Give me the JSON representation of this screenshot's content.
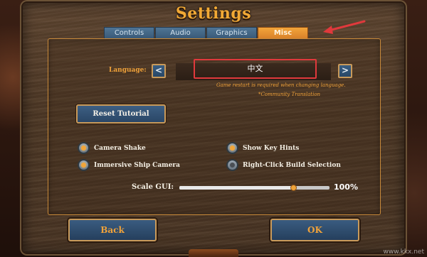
{
  "window": {
    "title": "Settings"
  },
  "tabs": [
    {
      "label": "Controls",
      "active": false
    },
    {
      "label": "Audio",
      "active": false
    },
    {
      "label": "Graphics",
      "active": false
    },
    {
      "label": "Misc",
      "active": true
    }
  ],
  "language": {
    "label": "Language:",
    "value": "中文",
    "prev_icon": "chevron-left-icon",
    "next_icon": "chevron-right-icon",
    "prev_glyph": "<",
    "next_glyph": ">",
    "restart_note": "Game restart is required when changing language.",
    "community_note": "*Community Translation"
  },
  "reset_tutorial": {
    "label": "Reset Tutorial"
  },
  "options": [
    {
      "label": "Camera Shake",
      "checked": true
    },
    {
      "label": "Show Key Hints",
      "checked": true
    },
    {
      "label": "Immersive Ship Camera",
      "checked": true
    },
    {
      "label": "Right-Click Build Selection",
      "checked": false
    }
  ],
  "scale_gui": {
    "label": "Scale GUI:",
    "value_text": "100%",
    "fraction": 0.76
  },
  "footer": {
    "back_label": "Back",
    "ok_label": "OK"
  },
  "colors": {
    "accent": "#f0a23a",
    "button_blue": "#2f4f72",
    "annotation_red": "#e0393c"
  },
  "watermark": "www.kkx.net"
}
